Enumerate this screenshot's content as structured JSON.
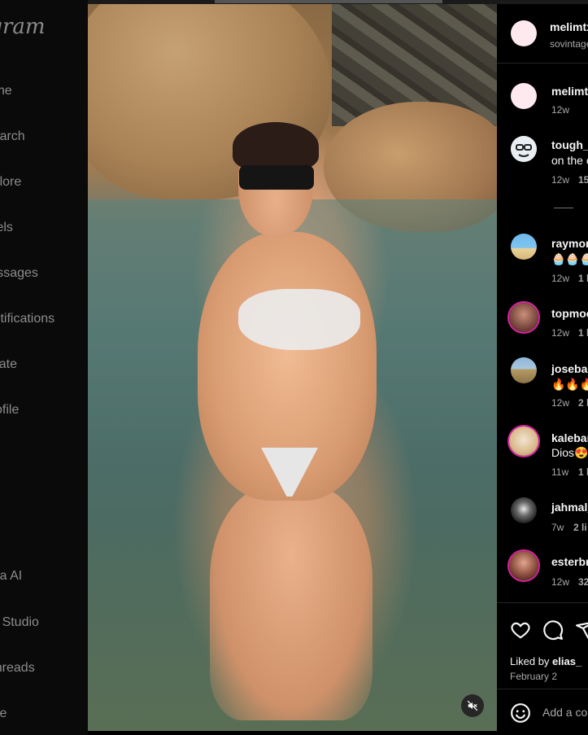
{
  "brand": {
    "logo_text": "Instagram"
  },
  "sidebar": {
    "items": [
      {
        "label": "Home",
        "icon": "home-icon"
      },
      {
        "label": "Search",
        "icon": "search-icon"
      },
      {
        "label": "Explore",
        "icon": "compass-icon"
      },
      {
        "label": "Reels",
        "icon": "reels-icon"
      },
      {
        "label": "Messages",
        "icon": "messenger-icon"
      },
      {
        "label": "Notifications",
        "icon": "heart-icon"
      },
      {
        "label": "Create",
        "icon": "plus-icon"
      },
      {
        "label": "Profile",
        "icon": "avatar-icon"
      },
      {
        "label": "Meta AI",
        "icon": "meta-ai-icon"
      },
      {
        "label": "AI Studio",
        "icon": "ai-studio-icon"
      },
      {
        "label": "Threads",
        "icon": "threads-icon"
      },
      {
        "label": "More",
        "icon": "menu-icon"
      }
    ]
  },
  "video": {
    "mute_icon": "speaker-muted-icon"
  },
  "post": {
    "author": "melimtx",
    "audio": "sovintage",
    "caption_author": "melimtx",
    "caption_age": "12w",
    "comments": [
      {
        "user": "tough_",
        "text": "on the e",
        "age": "12w",
        "likes": "15"
      },
      {
        "user": "raymon",
        "text": "🧁🧁🧁",
        "age": "12w",
        "likes": "1 l"
      },
      {
        "user": "topmoc",
        "text": "",
        "age": "12w",
        "likes": "1 l"
      },
      {
        "user": "josebac",
        "text": "🔥🔥🔥",
        "age": "12w",
        "likes": "2 l"
      },
      {
        "user": "kalebar",
        "text": "Dios😍",
        "age": "11w",
        "likes": "1 l"
      },
      {
        "user": "jahmal_",
        "text": "",
        "age": "7w",
        "likes": "2 li"
      },
      {
        "user": "esterbr",
        "text": "",
        "age": "12w",
        "likes": "32"
      }
    ],
    "liked_prefix": "Liked by",
    "liked_user": "elias_",
    "date": "February 2",
    "add_comment_placeholder": "Add a co"
  },
  "colors": {
    "panel_bg": "#000000",
    "divider": "#262626",
    "muted_text": "#a8a8a8",
    "story_ring": "#d6249f"
  }
}
